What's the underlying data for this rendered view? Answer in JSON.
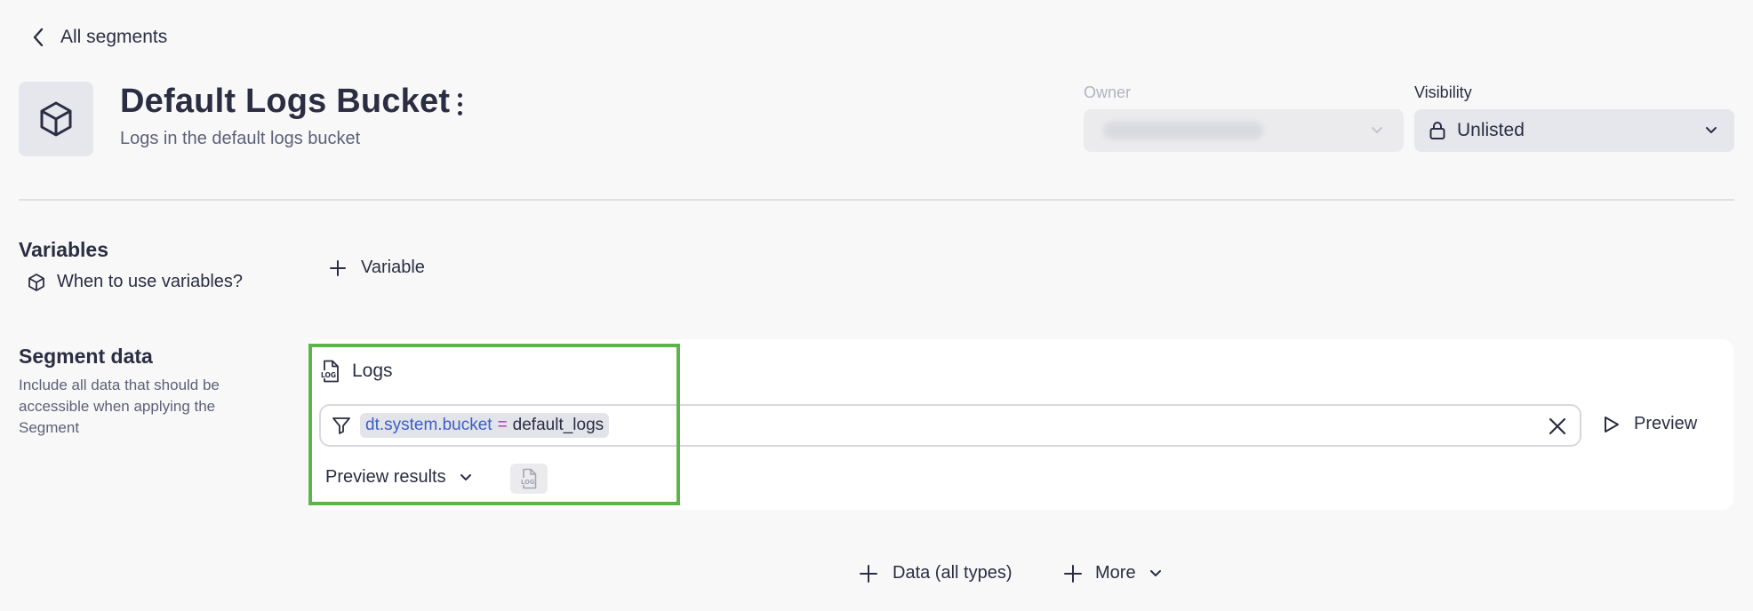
{
  "nav": {
    "back_label": "All segments"
  },
  "header": {
    "title": "Default Logs Bucket",
    "subtitle": "Logs in the default logs bucket",
    "icon": "cube-icon"
  },
  "owner": {
    "label": "Owner",
    "value_hidden": true
  },
  "visibility": {
    "label": "Visibility",
    "value": "Unlisted",
    "icon": "lock-icon"
  },
  "variables": {
    "heading": "Variables",
    "help_link": "When to use variables?",
    "add_label": "Variable"
  },
  "segment_data": {
    "heading": "Segment data",
    "description": "Include all data that should be accessible when applying the Segment",
    "source_label": "Logs",
    "filter": {
      "key": "dt.system.bucket",
      "operator": "=",
      "value": "default_logs"
    },
    "preview_button": "Preview",
    "preview_results_label": "Preview results"
  },
  "actions": {
    "add_data_label": "Data (all types)",
    "more_label": "More"
  },
  "colors": {
    "highlight": "#5cb547",
    "filter_key": "#3b5fc4",
    "filter_operator": "#a23aa6",
    "background": "#f8f8f9"
  }
}
